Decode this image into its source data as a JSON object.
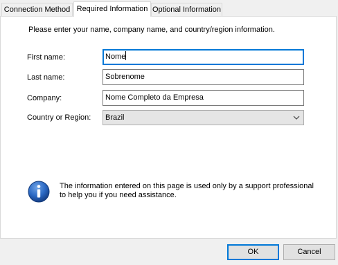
{
  "tabs": [
    {
      "label": "Connection Method",
      "active": false
    },
    {
      "label": "Required Information",
      "active": true
    },
    {
      "label": "Optional Information",
      "active": false
    }
  ],
  "intro": "Please enter your name, company name, and country/region information.",
  "form": {
    "first_name": {
      "label": "First name:",
      "value": "Nome"
    },
    "last_name": {
      "label": "Last name:",
      "value": "Sobrenome"
    },
    "company": {
      "label": "Company:",
      "value": "Nome Completo da Empresa"
    },
    "country": {
      "label": "Country or Region:",
      "value": "Brazil"
    }
  },
  "info": {
    "icon": "info-icon",
    "text": "The information entered on this page is used only by a support professional to help you if you need assistance."
  },
  "buttons": {
    "ok": "OK",
    "cancel": "Cancel"
  },
  "colors": {
    "focus": "#0078d7",
    "panel": "#ffffff",
    "background": "#f0f0f0",
    "info_icon": "#1d5aa8"
  }
}
